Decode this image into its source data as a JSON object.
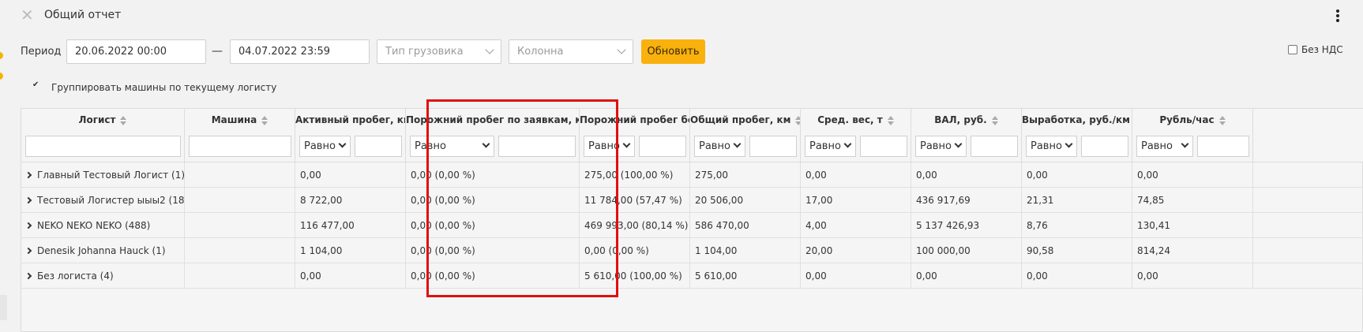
{
  "header": {
    "title": "Общий отчет",
    "close_icon": "close-icon",
    "menu_icon": "kebab-menu-icon"
  },
  "filters": {
    "period_label": "Период",
    "date_from": "20.06.2022 00:00",
    "date_separator": "—",
    "date_to": "04.07.2022 23:59",
    "truck_type_placeholder": "Тип грузовика",
    "column_placeholder": "Колонна",
    "refresh_label": "Обновить",
    "no_vat_label": "Без НДС",
    "no_vat_checked": false,
    "group_by_logist_label": "Группировать машины по текущему логисту",
    "group_by_logist_checked": true
  },
  "table": {
    "columns": [
      {
        "title": "Логист",
        "filter": "text"
      },
      {
        "title": "Машина",
        "filter": "text"
      },
      {
        "title": "Активный пробег, км",
        "filter": "op",
        "op": "Равно"
      },
      {
        "title": "Порожний пробег по заявкам, км",
        "filter": "op",
        "op": "Равно"
      },
      {
        "title": "Порожний пробег бе...",
        "filter": "op",
        "op": "Равно"
      },
      {
        "title": "Общий пробег, км",
        "filter": "op",
        "op": "Равно"
      },
      {
        "title": "Сред. вес, т",
        "filter": "op",
        "op": "Равно"
      },
      {
        "title": "ВАЛ, руб.",
        "filter": "op",
        "op": "Равно"
      },
      {
        "title": "Выработка, руб./км",
        "filter": "op",
        "op": "Равно"
      },
      {
        "title": "Рубль/час",
        "filter": "op",
        "op": "Равно"
      }
    ],
    "rows": [
      [
        "Главный Тестовый Логист (1)",
        "",
        "0,00",
        "0,00 (0,00 %)",
        "275,00 (100,00 %)",
        "275,00",
        "0,00",
        "0,00",
        "0,00",
        "0,00"
      ],
      [
        "Тестовый Логистер ыыы2 (18)",
        "",
        "8 722,00",
        "0,00 (0,00 %)",
        "11 784,00 (57,47 %)",
        "20 506,00",
        "17,00",
        "436 917,69",
        "21,31",
        "74,85"
      ],
      [
        "NEKO NEKO NEKO (488)",
        "",
        "116 477,00",
        "0,00 (0,00 %)",
        "469 993,00 (80,14 %)",
        "586 470,00",
        "4,00",
        "5 137 426,93",
        "8,76",
        "130,41"
      ],
      [
        "Denesik Johanna Hauck (1)",
        "",
        "1 104,00",
        "0,00 (0,00 %)",
        "0,00 (0,00 %)",
        "1 104,00",
        "20,00",
        "100 000,00",
        "90,58",
        "814,24"
      ],
      [
        "Без логиста (4)",
        "",
        "0,00",
        "0,00 (0,00 %)",
        "5 610,00 (100,00 %)",
        "5 610,00",
        "0,00",
        "0,00",
        "0,00",
        "0,00"
      ]
    ]
  },
  "colors": {
    "accent": "#f9b10e",
    "highlight": "#e01010"
  }
}
